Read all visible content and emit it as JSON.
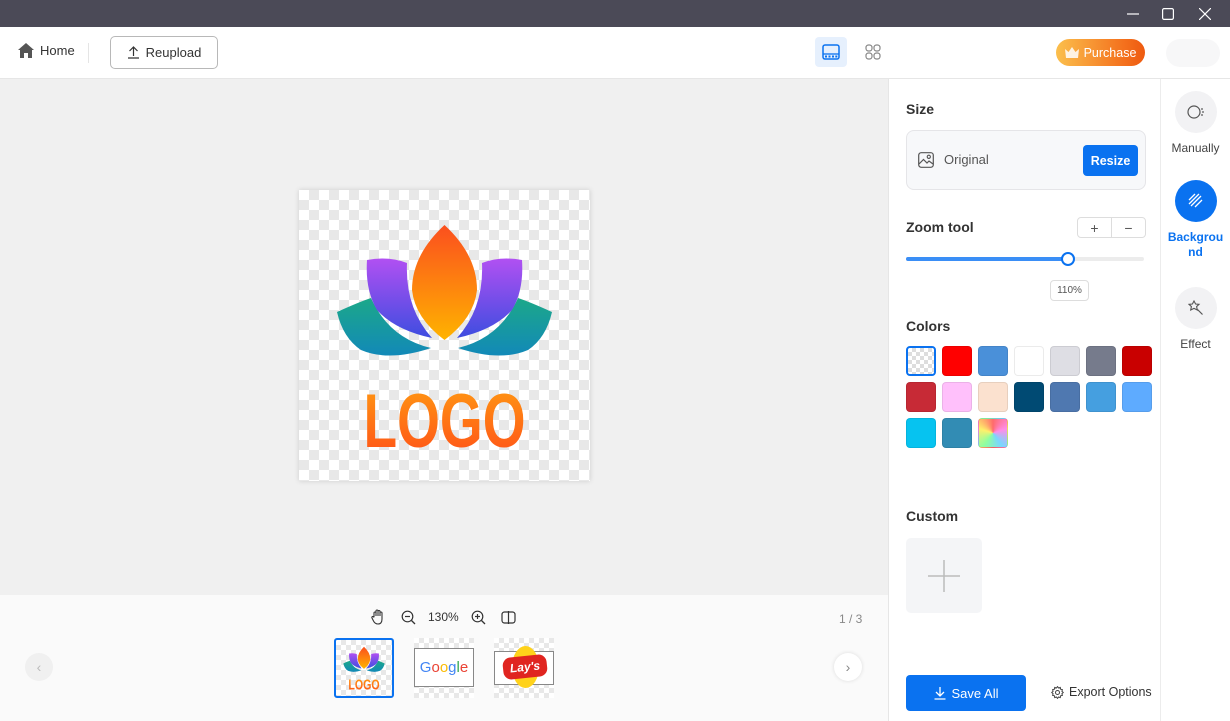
{
  "window": {
    "controls": [
      "minimize",
      "maximize",
      "close"
    ]
  },
  "toolbar": {
    "home_label": "Home",
    "reupload_label": "Reupload",
    "view_modes": [
      {
        "name": "single-view",
        "active": true
      },
      {
        "name": "grid-view",
        "active": false
      }
    ],
    "purchase_label": "Purchase"
  },
  "canvas": {
    "image_text": "LOGO"
  },
  "bottombar": {
    "zoom_level": "130%",
    "page_indicator": "1 / 3",
    "thumbnails": [
      {
        "label": "LOGO",
        "selected": true
      },
      {
        "label": "Google",
        "selected": false
      },
      {
        "label": "Lay's",
        "selected": false
      }
    ]
  },
  "panel": {
    "size": {
      "title": "Size",
      "option_label": "Original",
      "resize_label": "Resize"
    },
    "zoom_tool": {
      "title": "Zoom tool",
      "plus": "+",
      "minus": "−",
      "value_label": "110%",
      "slider_fraction": 0.68
    },
    "colors": {
      "title": "Colors",
      "swatches": [
        {
          "name": "transparent",
          "color": "transparent",
          "selected": true
        },
        {
          "name": "red",
          "color": "#ff0000"
        },
        {
          "name": "blue",
          "color": "#4a90d9"
        },
        {
          "name": "white",
          "color": "#ffffff"
        },
        {
          "name": "light-gray",
          "color": "#dedee4"
        },
        {
          "name": "slate-gray",
          "color": "#767b8c"
        },
        {
          "name": "dark-red",
          "color": "#c90000"
        },
        {
          "name": "crimson",
          "color": "#c72a36"
        },
        {
          "name": "pink",
          "color": "#ffc0fb"
        },
        {
          "name": "peach",
          "color": "#fbe1cf"
        },
        {
          "name": "navy",
          "color": "#004a73"
        },
        {
          "name": "steel-blue",
          "color": "#4f78b0"
        },
        {
          "name": "sky-blue",
          "color": "#459fe0"
        },
        {
          "name": "light-blue",
          "color": "#5eabff"
        },
        {
          "name": "cyan",
          "color": "#06c3f0"
        },
        {
          "name": "teal-blue",
          "color": "#328cb4"
        },
        {
          "name": "rainbow",
          "color": "gradient"
        }
      ]
    },
    "custom": {
      "title": "Custom"
    },
    "save_all_label": "Save All",
    "export_options_label": "Export Options"
  },
  "rail": {
    "items": [
      {
        "label": "Manually",
        "active": false
      },
      {
        "label": "Background",
        "active": true
      },
      {
        "label": "Effect",
        "active": false
      }
    ]
  },
  "colors": {
    "accent": "#0a72f0",
    "titlebar": "#4b4a57",
    "purchase_start": "#fbbf4c",
    "purchase_end": "#ee5a10"
  }
}
